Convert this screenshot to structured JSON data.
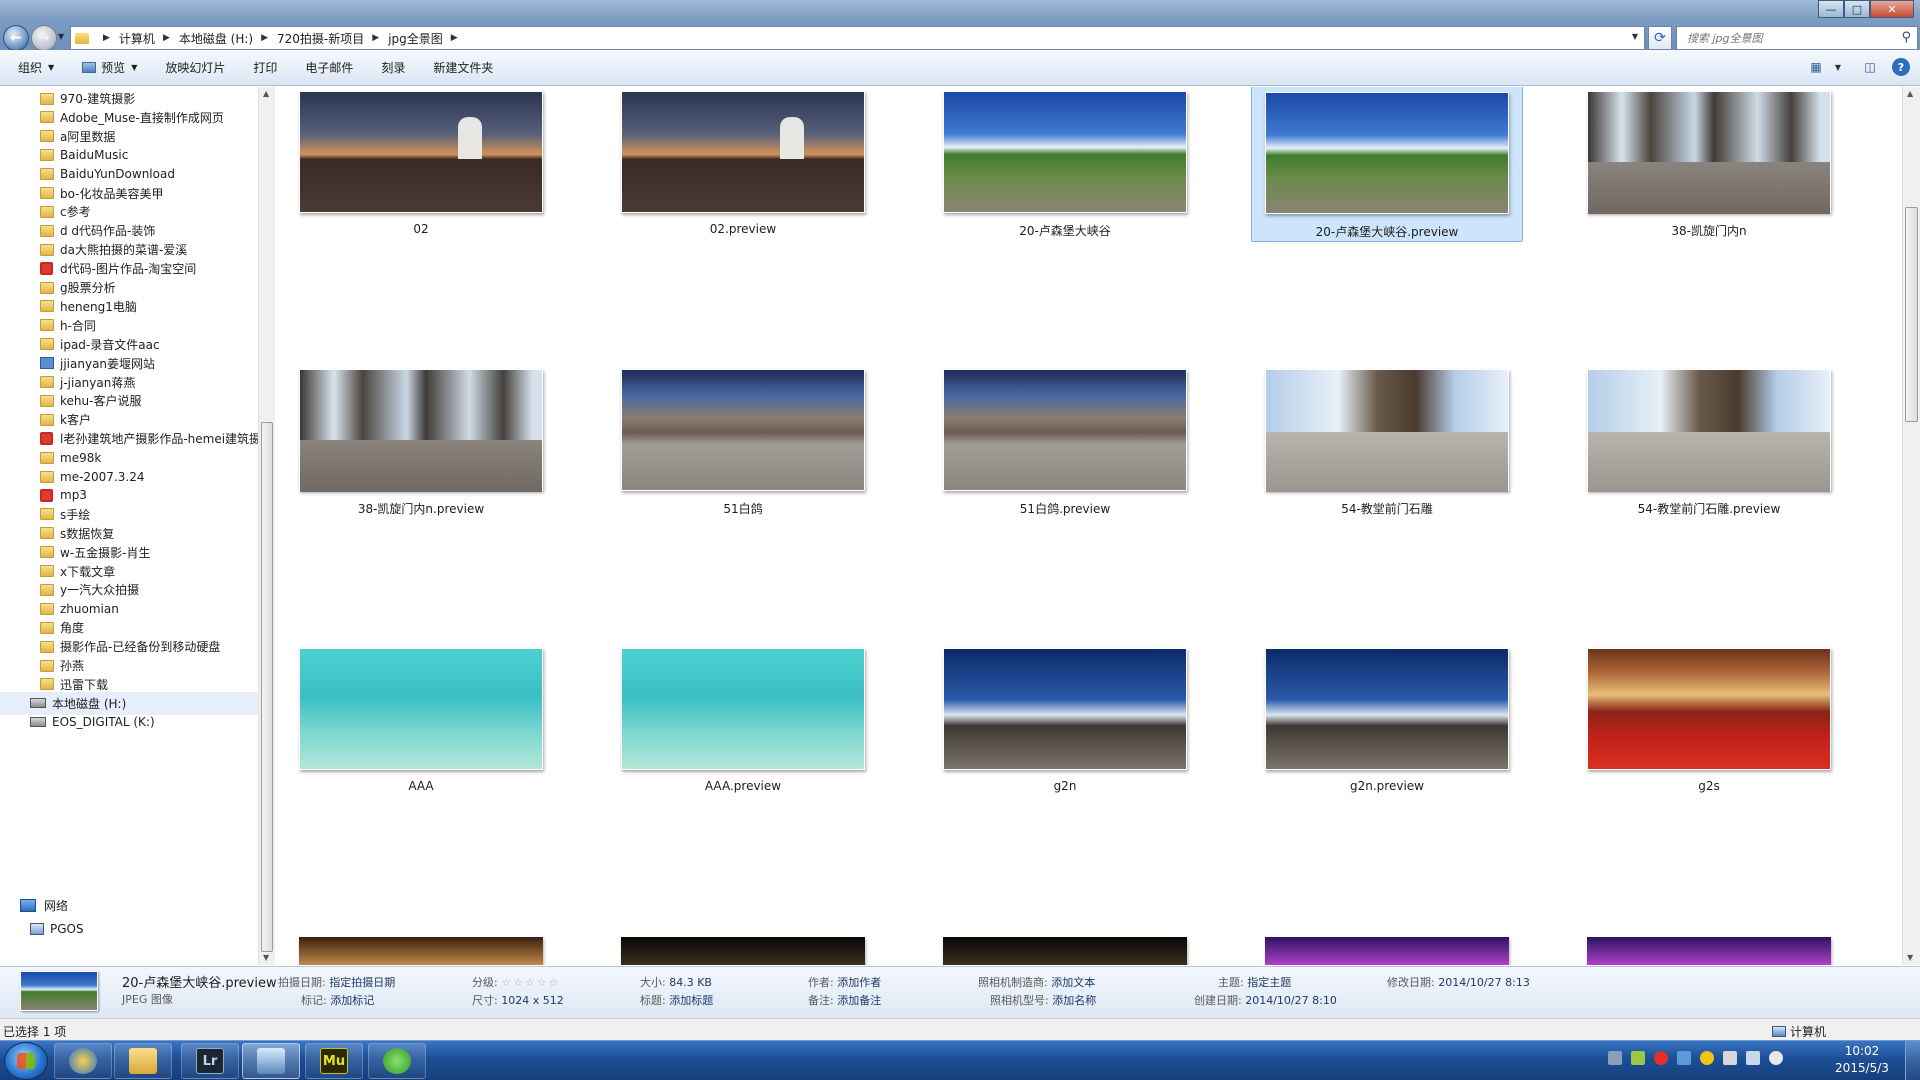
{
  "window": {
    "breadcrumbs": [
      "计算机",
      "本地磁盘 (H:)",
      "720拍摄-新项目",
      "jpg全景图"
    ],
    "search_placeholder": "搜索 jpg全景图",
    "controls": {
      "minimize": "—",
      "maximize": "□",
      "close": "✕"
    }
  },
  "toolbar": {
    "organize": "组织",
    "preview": "预览",
    "slideshow": "放映幻灯片",
    "print": "打印",
    "email": "电子邮件",
    "burn": "刻录",
    "new_folder": "新建文件夹"
  },
  "sidebar": {
    "items": [
      {
        "label": "970-建筑摄影",
        "icon": "folder"
      },
      {
        "label": "Adobe_Muse-直接制作成网页",
        "icon": "folder"
      },
      {
        "label": "a阿里数据",
        "icon": "folder"
      },
      {
        "label": "BaiduMusic",
        "icon": "folder"
      },
      {
        "label": "BaiduYunDownload",
        "icon": "folder"
      },
      {
        "label": "bo-化妆品美容美甲",
        "icon": "folder"
      },
      {
        "label": "c参考",
        "icon": "folder"
      },
      {
        "label": "d d代码作品-装饰",
        "icon": "folder"
      },
      {
        "label": "da大熊拍摄的菜谱-爱溪",
        "icon": "folder"
      },
      {
        "label": "d代码-图片作品-淘宝空间",
        "icon": "red"
      },
      {
        "label": "g股票分析",
        "icon": "folder"
      },
      {
        "label": "heneng1电脑",
        "icon": "folder"
      },
      {
        "label": "h-合同",
        "icon": "folder"
      },
      {
        "label": "ipad-录音文件aac",
        "icon": "folder"
      },
      {
        "label": "jjianyan姜堰网站",
        "icon": "blue"
      },
      {
        "label": "j-jianyan蒋燕",
        "icon": "folder"
      },
      {
        "label": "kehu-客户说服",
        "icon": "folder"
      },
      {
        "label": "k客户",
        "icon": "folder"
      },
      {
        "label": "l老孙建筑地产摄影作品-hemei建筑摄",
        "icon": "red"
      },
      {
        "label": "me98k",
        "icon": "folder"
      },
      {
        "label": "me-2007.3.24",
        "icon": "folder"
      },
      {
        "label": "mp3",
        "icon": "red"
      },
      {
        "label": "s手绘",
        "icon": "folder"
      },
      {
        "label": "s数据恢复",
        "icon": "folder"
      },
      {
        "label": "w-五金摄影-肖生",
        "icon": "folder"
      },
      {
        "label": "x下载文章",
        "icon": "folder"
      },
      {
        "label": "y一汽大众拍摄",
        "icon": "folder"
      },
      {
        "label": "zhuomian",
        "icon": "folder"
      },
      {
        "label": "角度",
        "icon": "folder"
      },
      {
        "label": "摄影作品-已经备份到移动硬盘",
        "icon": "folder"
      },
      {
        "label": "孙燕",
        "icon": "folder"
      },
      {
        "label": "迅雷下载",
        "icon": "folder"
      },
      {
        "label": "本地磁盘 (H:)",
        "icon": "drive",
        "selected": true
      },
      {
        "label": "EOS_DIGITAL (K:)",
        "icon": "drive"
      }
    ],
    "network": {
      "label": "网络",
      "children": [
        "PGOS"
      ]
    }
  },
  "files": [
    {
      "name": "02",
      "scene": "windmill"
    },
    {
      "name": "02.preview",
      "scene": "windmill"
    },
    {
      "name": "20-卢森堡大峡谷",
      "scene": "garden"
    },
    {
      "name": "20-卢森堡大峡谷.preview",
      "scene": "garden",
      "selected": true
    },
    {
      "name": "38-凯旋门内n",
      "scene": "arch"
    },
    {
      "name": "38-凯旋门内n.preview",
      "scene": "arch"
    },
    {
      "name": "51白鸽",
      "scene": "plaza"
    },
    {
      "name": "51白鸽.preview",
      "scene": "plaza"
    },
    {
      "name": "54-教堂前门石雕",
      "scene": "church"
    },
    {
      "name": "54-教堂前门石雕.preview",
      "scene": "church"
    },
    {
      "name": "AAA",
      "scene": "water"
    },
    {
      "name": "AAA.preview",
      "scene": "water"
    },
    {
      "name": "g2n",
      "scene": "coast"
    },
    {
      "name": "g2n.preview",
      "scene": "coast"
    },
    {
      "name": "g2s",
      "scene": "hall"
    }
  ],
  "partial_row": [
    "hall2",
    "dark",
    "dark",
    "purple",
    "purple"
  ],
  "details": {
    "name": "20-卢森堡大峡谷.preview",
    "type": "JPEG 图像",
    "date_taken_label": "拍摄日期:",
    "date_taken": "指定拍摄日期",
    "tags_label": "标记:",
    "tags": "添加标记",
    "rating_label": "分级:",
    "stars": "☆☆☆☆☆",
    "dimensions_label": "尺寸:",
    "dimensions": "1024 x 512",
    "size_label": "大小:",
    "size": "84.3 KB",
    "title_label": "标题:",
    "title": "添加标题",
    "author_label": "作者:",
    "author": "添加作者",
    "comments_label": "备注:",
    "comments": "添加备注",
    "camera_maker_label": "照相机制造商:",
    "camera_maker": "添加文本",
    "camera_model_label": "照相机型号:",
    "camera_model": "添加名称",
    "subject_label": "主题:",
    "subject": "指定主题",
    "created_label": "创建日期:",
    "created": "2014/10/27 8:10",
    "modified_label": "修改日期:",
    "modified": "2014/10/27 8:13"
  },
  "status": {
    "selected": "已选择 1 项",
    "location": "计算机"
  },
  "taskbar": {
    "apps": [
      {
        "name": "qq",
        "glyph": ""
      },
      {
        "name": "explorer",
        "glyph": ""
      },
      {
        "name": "lightroom",
        "glyph": "Lr"
      },
      {
        "name": "monitor",
        "glyph": ""
      },
      {
        "name": "muse",
        "glyph": "Mu"
      },
      {
        "name": "refresh-app",
        "glyph": ""
      }
    ],
    "time": "10:02",
    "date": "2015/5/3"
  }
}
